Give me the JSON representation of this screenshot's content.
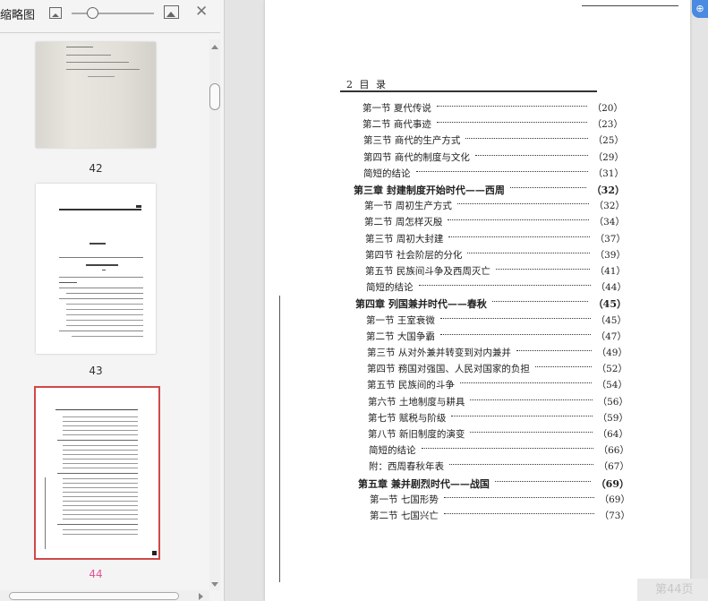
{
  "panel": {
    "title": "缩略图",
    "icons": [
      "zoom-out-icon",
      "zoom-slider",
      "zoom-in-icon",
      "close-icon"
    ],
    "close_glyph": "✕",
    "thumbnails": [
      {
        "label": "42"
      },
      {
        "label": "43"
      },
      {
        "label": "44",
        "selected": true
      }
    ],
    "accent_color": "#d04848",
    "selected_label_color": "#e0559a"
  },
  "document": {
    "header": "2 目  录",
    "entries": [
      {
        "label": "第一节   夏代传说",
        "page": "（20）",
        "level": 2
      },
      {
        "label": "第二节   商代事迹",
        "page": "（23）",
        "level": 2
      },
      {
        "label": "第三节   商代的生产方式",
        "page": "（25）",
        "level": 2
      },
      {
        "label": "第四节   商代的制度与文化",
        "page": "（29）",
        "level": 2
      },
      {
        "label": "简短的结论",
        "page": "（31）",
        "level": 2
      },
      {
        "label": "第三章  封建制度开始时代——西周",
        "page": "（32）",
        "level": 1
      },
      {
        "label": "第一节   周初生产方式",
        "page": "（32）",
        "level": 2
      },
      {
        "label": "第二节   周怎样灭殷",
        "page": "（34）",
        "level": 2
      },
      {
        "label": "第三节   周初大封建",
        "page": "（37）",
        "level": 2
      },
      {
        "label": "第四节   社会阶层的分化",
        "page": "（39）",
        "level": 2
      },
      {
        "label": "第五节   民族间斗争及西周灭亡",
        "page": "（41）",
        "level": 2
      },
      {
        "label": "简短的结论",
        "page": "（44）",
        "level": 2
      },
      {
        "label": "第四章  列国兼并时代——春秋",
        "page": "（45）",
        "level": 1
      },
      {
        "label": "第一节   王室衰微",
        "page": "（45）",
        "level": 2
      },
      {
        "label": "第二节   大国争霸",
        "page": "（47）",
        "level": 2
      },
      {
        "label": "第三节   从对外兼并转变到对内兼并",
        "page": "（49）",
        "level": 2
      },
      {
        "label": "第四节   務国对强国、人民对国家的负担",
        "page": "（52）",
        "level": 2
      },
      {
        "label": "第五节   民族间的斗争",
        "page": "（54）",
        "level": 2
      },
      {
        "label": "第六节   土地制度与耕具",
        "page": "（56）",
        "level": 2
      },
      {
        "label": "第七节   赋税与阶级",
        "page": "（59）",
        "level": 2
      },
      {
        "label": "第八节   新旧制度的演变",
        "page": "（64）",
        "level": 2
      },
      {
        "label": "简短的结论",
        "page": "（66）",
        "level": 2
      },
      {
        "label": "附：西周春秋年表",
        "page": "（67）",
        "level": 2
      },
      {
        "label": "第五章  兼并剧烈时代——战国",
        "page": "（69）",
        "level": 1
      },
      {
        "label": "第一节   七国形势",
        "page": "（69）",
        "level": 2
      },
      {
        "label": "第二节   七国兴亡",
        "page": "（73）",
        "level": 2
      }
    ]
  },
  "status": {
    "page_indicator": "第44页"
  },
  "corner_badge": "⊕"
}
